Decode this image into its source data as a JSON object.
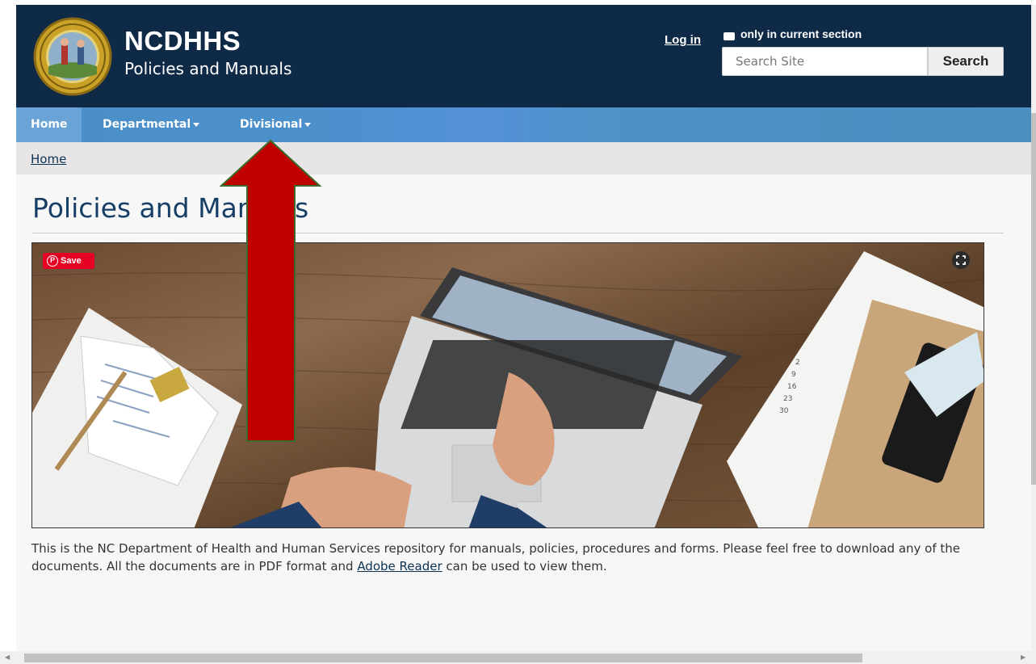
{
  "header": {
    "brand_title": "NCDHHS",
    "brand_subtitle": "Policies and Manuals",
    "login_label": "Log in",
    "section_checkbox_label": "only in current section",
    "search_placeholder": "Search Site",
    "search_button": "Search",
    "colors": {
      "background": "#0f2a47",
      "text": "#ffffff"
    }
  },
  "nav": {
    "items": [
      {
        "label": "Home",
        "active": true
      },
      {
        "label": "Departmental",
        "dropdown": true
      },
      {
        "label": "Divisional",
        "dropdown": true
      }
    ],
    "colors": {
      "bar": "#4a8fc7",
      "active": "#6aa3d6"
    }
  },
  "breadcrumb": {
    "items": [
      "Home"
    ]
  },
  "main": {
    "title": "Policies and Manuals",
    "hero": {
      "pin_save_label": "Save",
      "icons": [
        "pinterest-icon",
        "expand-icon"
      ]
    },
    "intro_before_link": "This is the NC Department of Health and Human Services repository for manuals, policies, procedures and forms. Please feel free to download any of the documents. All the documents are in PDF format and ",
    "intro_link": "Adobe Reader",
    "intro_after_link": " can be used to view them."
  },
  "annotation": {
    "arrow_color": "#c00000",
    "arrow_border": "#3a6b2a"
  }
}
